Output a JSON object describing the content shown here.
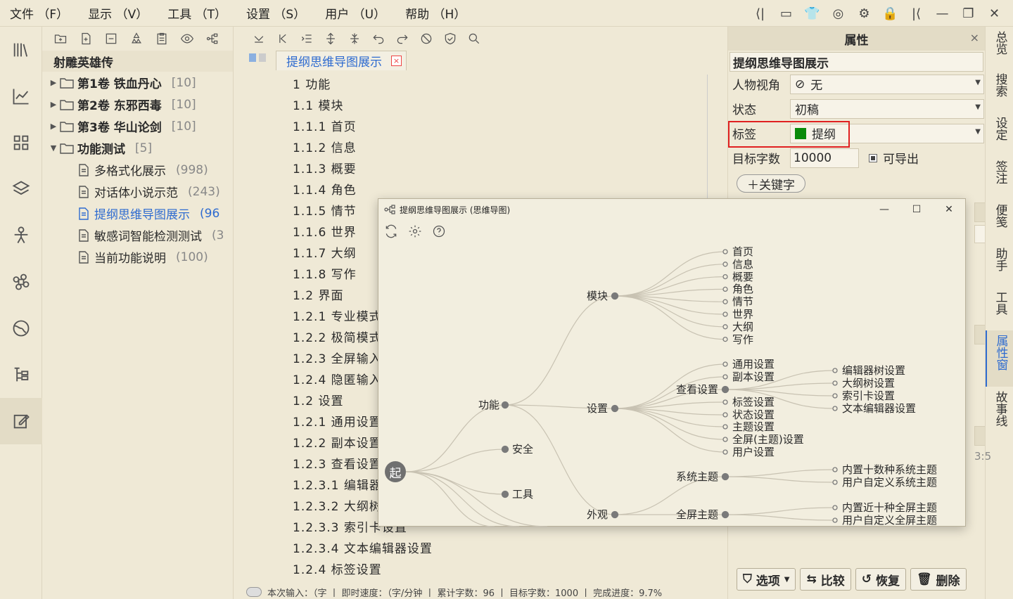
{
  "menubar": {
    "items": [
      "文件 （F）",
      "显示 （V）",
      "工具 （T）",
      "设置 （S）",
      "用户 （U）",
      "帮助 （H）"
    ]
  },
  "tree": {
    "title": "射雕英雄传",
    "volumes": [
      {
        "label": "第1卷 铁血丹心",
        "count": "[10]"
      },
      {
        "label": "第2卷 东邪西毒",
        "count": "[10]"
      },
      {
        "label": "第3卷 华山论剑",
        "count": "[10]"
      },
      {
        "label": "功能测试",
        "count": "[5]"
      }
    ],
    "docs": [
      {
        "label": "多格式化展示",
        "count": "(998)"
      },
      {
        "label": "对话体小说示范",
        "count": "(243)"
      },
      {
        "label": "提纲思维导图展示",
        "count": "(96"
      },
      {
        "label": "敏感词智能检测测试",
        "count": "(3"
      },
      {
        "label": "当前功能说明",
        "count": "(100)"
      }
    ]
  },
  "editor": {
    "tab_title": "提纲思维导图展示",
    "tab_close": "×",
    "outline": [
      "1 功能",
      "1.1 模块",
      "1.1.1 首页",
      "1.1.2 信息",
      "1.1.3 概要",
      "1.1.4 角色",
      "1.1.5 情节",
      "1.1.6 世界",
      "1.1.7 大纲",
      "1.1.8 写作",
      "1.2 界面",
      "1.2.1 专业模式",
      "1.2.2 极简模式",
      "1.2.3 全屏输入",
      "1.2.4 隐匿输入",
      "1.2 设置",
      "1.2.1 通用设置",
      "1.2.2 副本设置",
      "1.2.3 查看设置",
      "1.2.3.1 编辑器",
      "1.2.3.2 大纲树",
      "1.2.3.3 索引卡设置",
      "1.2.3.4 文本编辑器设置",
      "1.2.4 标签设置"
    ],
    "status": [
      "本次输入：（字",
      "即时速度：（字/分钟",
      "累计字数：96",
      "目标字数：1000",
      "完成进度：9.7%"
    ]
  },
  "properties": {
    "header": "属性",
    "close": "×",
    "doc_title": "提纲思维导图展示",
    "pov_label": "人物视角",
    "pov_value": "无",
    "status_label": "状态",
    "status_value": "初稿",
    "tag_label": "标签",
    "tag_value": "提纲",
    "tag_color": "#0a8a0a",
    "target_label": "目标字数",
    "target_value": "10000",
    "exportable_label": "可导出",
    "keyword_button": "＋关键字",
    "side_time": "3:5",
    "buttons": {
      "options": "选项",
      "compare": "比较",
      "restore": "恢复",
      "delete": "删除"
    }
  },
  "right_tabs": [
    "总览",
    "搜索",
    "设定",
    "签注",
    "便笺",
    "助手",
    "工具",
    "属性窗",
    "故事线"
  ],
  "mindmap": {
    "title": "提纲思维导图展示 (思维导图)",
    "root": "起",
    "level1": [
      "功能",
      "安全",
      "工具"
    ],
    "level2": [
      "模块",
      "设置",
      "外观"
    ],
    "modules": [
      "首页",
      "信息",
      "概要",
      "角色",
      "情节",
      "世界",
      "大纲",
      "写作"
    ],
    "settings": [
      "通用设置",
      "副本设置",
      "查看设置",
      "标签设置",
      "状态设置",
      "主题设置",
      "全屏(主题)设置",
      "用户设置"
    ],
    "view_settings": [
      "编辑器树设置",
      "大纲树设置",
      "索引卡设置",
      "文本编辑器设置"
    ],
    "appearance": [
      "系统主题",
      "全屏主题"
    ],
    "system_themes": [
      "内置十数种系统主题",
      "用户自定义系统主题"
    ],
    "fullscreen_themes": [
      "内置近十种全屏主题",
      "用户自定义全屏主题"
    ]
  }
}
